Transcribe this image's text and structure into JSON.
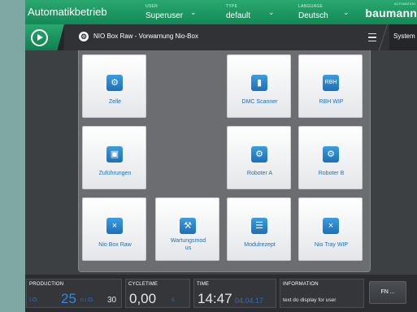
{
  "header": {
    "title": "Automatikbetrieb",
    "user": {
      "label": "USER",
      "value": "Superuser"
    },
    "type": {
      "label": "TYPE",
      "value": "default"
    },
    "language": {
      "label": "LANGUAGE",
      "value": "Deutsch"
    },
    "brand": "baumann",
    "brand_sub": "AUTOMATION",
    "accent": "#1a9a62"
  },
  "subbar": {
    "breadcrumb": "NIO Box Raw - Vorwarnung Nio-Box",
    "system_label": "System"
  },
  "tiles": {
    "zelle": {
      "label": "Zelle",
      "icon": "gears-icon"
    },
    "dmc_scanner": {
      "label": "DMC Scanner",
      "icon": "scanner-icon"
    },
    "rbh_wip": {
      "label": "RBH WIP",
      "icon_text": "RBH"
    },
    "zufuehrungen": {
      "label": "Zuführungen",
      "icon": "box-icon"
    },
    "roboter_a": {
      "label": "Roboter A",
      "icon": "robot-icon"
    },
    "roboter_b": {
      "label": "Roboter B",
      "icon": "robot-icon"
    },
    "nio_box_raw": {
      "label": "Nio Box Raw",
      "icon": "tray-icon"
    },
    "wartungsmodus": {
      "label_line1": "Wartungsmod",
      "label_line2": "us",
      "icon": "wrench-icon"
    },
    "modulrezept": {
      "label": "Modulrezept",
      "icon": "clipboard-icon"
    },
    "nio_tray_wip": {
      "label": "Nio Tray WIP",
      "icon": "tray-icon"
    }
  },
  "footer": {
    "production": {
      "label": "PRODUCTION",
      "io_label": "I.O.",
      "io_value": "25",
      "nio_label": "n.i.O.",
      "nio_value": "30"
    },
    "cycletime": {
      "label": "CYCLETIME",
      "value": "0,00",
      "unit": "s"
    },
    "time": {
      "label": "TIME",
      "clock": "14:47",
      "date": "04.04.17"
    },
    "information": {
      "label": "INFORMATION",
      "text": "text do display for user"
    },
    "fn_button": "FN ..."
  }
}
